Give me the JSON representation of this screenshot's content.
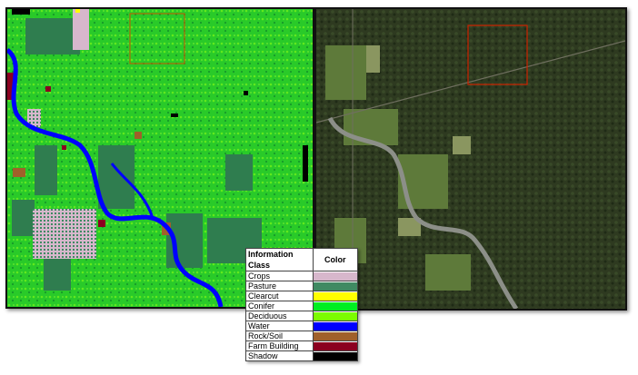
{
  "legend": {
    "header_class": "Information Class",
    "header_color": "Color",
    "rows": [
      {
        "name": "Crops",
        "color": "#d7b7cc"
      },
      {
        "name": "Pasture",
        "color": "#3f8a62"
      },
      {
        "name": "Clearcut",
        "color": "#ffff00"
      },
      {
        "name": "Conifer",
        "color": "#00ee22"
      },
      {
        "name": "Deciduous",
        "color": "#7cfc00"
      },
      {
        "name": "Water",
        "color": "#0000ff"
      },
      {
        "name": "Rock/Soil",
        "color": "#a0602a"
      },
      {
        "name": "Farm Building",
        "color": "#8b0020"
      },
      {
        "name": "Shadow",
        "color": "#000000"
      }
    ]
  },
  "colors": {
    "highlight_box": "#cc2200",
    "aerial_base": "#2f3a22"
  }
}
